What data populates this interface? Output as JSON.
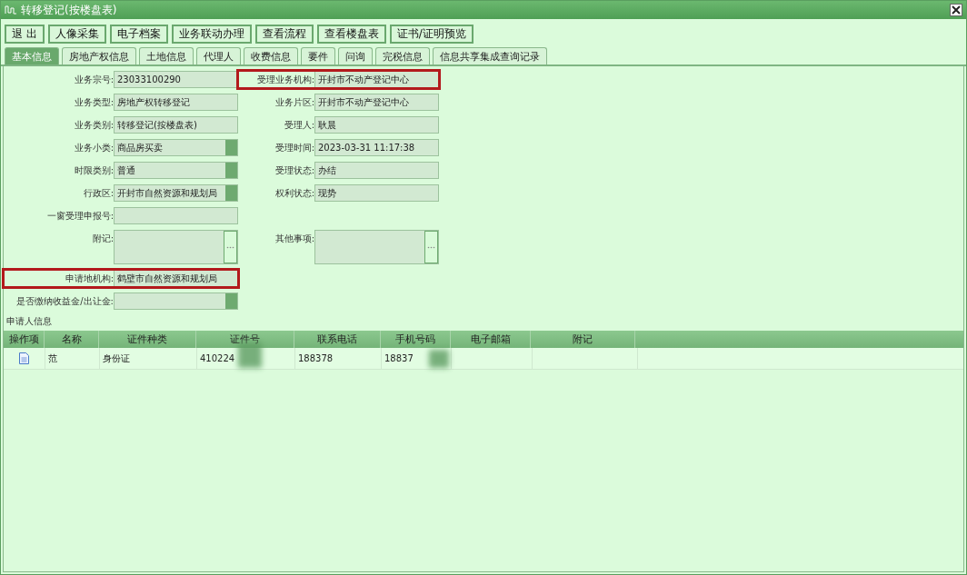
{
  "window": {
    "title": "转移登记(按楼盘表)"
  },
  "toolbar": [
    "退 出",
    "人像采集",
    "电子档案",
    "业务联动办理",
    "查看流程",
    "查看楼盘表",
    "证书/证明预览"
  ],
  "tabs": [
    {
      "label": "基本信息",
      "selected": true
    },
    {
      "label": "房地产权信息",
      "selected": false
    },
    {
      "label": "土地信息",
      "selected": false
    },
    {
      "label": "代理人",
      "selected": false
    },
    {
      "label": "收费信息",
      "selected": false
    },
    {
      "label": "要件",
      "selected": false
    },
    {
      "label": "问询",
      "selected": false
    },
    {
      "label": "完税信息",
      "selected": false
    },
    {
      "label": "信息共享集成查询记录",
      "selected": false
    }
  ],
  "form_rows": [
    {
      "left": {
        "label": "业务宗号:",
        "value": "23033100290",
        "kind": "text",
        "highlighted": false
      },
      "right": {
        "label": "受理业务机构:",
        "value": "开封市不动产登记中心",
        "kind": "text",
        "highlighted": true
      }
    },
    {
      "left": {
        "label": "业务类型:",
        "value": "房地产权转移登记",
        "kind": "text",
        "highlighted": false
      },
      "right": {
        "label": "业务片区:",
        "value": "开封市不动产登记中心",
        "kind": "text",
        "highlighted": false
      }
    },
    {
      "left": {
        "label": "业务类别:",
        "value": "转移登记(按楼盘表)",
        "kind": "text",
        "highlighted": false
      },
      "right": {
        "label": "受理人:",
        "value": "耿晨",
        "kind": "text",
        "highlighted": false
      }
    },
    {
      "left": {
        "label": "业务小类:",
        "value": "商品房买卖",
        "kind": "select",
        "highlighted": false
      },
      "right": {
        "label": "受理时间:",
        "value": "2023-03-31 11:17:38",
        "kind": "text",
        "highlighted": false
      }
    },
    {
      "left": {
        "label": "时限类别:",
        "value": "普通",
        "kind": "select",
        "highlighted": false
      },
      "right": {
        "label": "受理状态:",
        "value": "办结",
        "kind": "text",
        "highlighted": false
      }
    },
    {
      "left": {
        "label": "行政区:",
        "value": "开封市自然资源和规划局",
        "kind": "select",
        "highlighted": false
      },
      "right": {
        "label": "权利状态:",
        "value": "现势",
        "kind": "text",
        "highlighted": false
      }
    },
    {
      "left": {
        "label": "一窗受理申报号:",
        "kind": "text",
        "highlighted": false
      }
    },
    {
      "left": {
        "label": "附记:",
        "kind": "memo",
        "highlighted": false
      },
      "right": {
        "label": "其他事项:",
        "kind": "memo",
        "highlighted": false
      }
    },
    {
      "left": {
        "label": "申请地机构:",
        "value": "鹤壁市自然资源和规划局",
        "kind": "text",
        "highlighted": true
      }
    },
    {
      "left": {
        "label": "是否缴纳收益金/出让金:",
        "kind": "select",
        "highlighted": false
      }
    }
  ],
  "applicants": {
    "title": "申请人信息",
    "columns": [
      "操作项",
      "名称",
      "证件种类",
      "证件号",
      "联系电话",
      "手机号码",
      "电子邮箱",
      "附记"
    ],
    "rows": [
      {
        "cells": [
          "",
          "范",
          "身份证",
          "410224",
          "188378",
          "18837"
        ]
      }
    ]
  }
}
